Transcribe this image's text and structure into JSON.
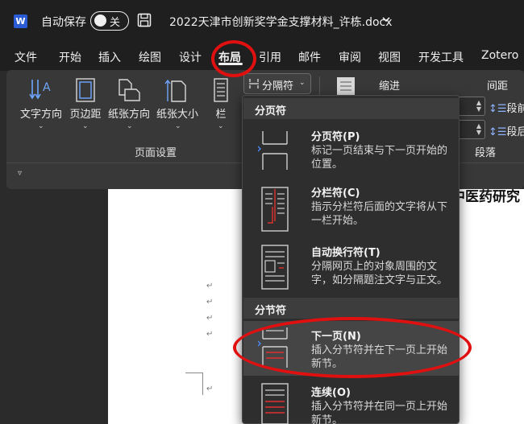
{
  "titlebar": {
    "app_icon": "W",
    "autosave_label": "自动保存",
    "toggle_state": "关",
    "doc_title": "2022天津市创新奖学金支撑材料_许栋.docx"
  },
  "tabs": {
    "file": "文件",
    "home": "开始",
    "insert": "插入",
    "draw": "绘图",
    "design": "设计",
    "layout": "布局",
    "references": "引用",
    "mailings": "邮件",
    "review": "审阅",
    "view": "视图",
    "developer": "开发工具",
    "zotero": "Zotero"
  },
  "ribbon": {
    "text_direction": "文字方向",
    "margins": "页边距",
    "orientation": "纸张方向",
    "size": "纸张大小",
    "columns": "栏",
    "breaks": "分隔符",
    "page_setup_group": "页面设置",
    "indent_label": "缩进",
    "spacing_label": "间距",
    "spacing_before": "段前",
    "spacing_after": "段后",
    "paragraph_group": "段落"
  },
  "document": {
    "snippet": "中医药研究",
    "para_mark": "↵"
  },
  "dropdown": {
    "page_breaks_header": "分页符",
    "section_breaks_header": "分节符",
    "items": [
      {
        "title": "分页符(P)",
        "desc": "标记一页结束与下一页开始的位置。"
      },
      {
        "title": "分栏符(C)",
        "desc": "指示分栏符后面的文字将从下一栏开始。"
      },
      {
        "title": "自动换行符(T)",
        "desc": "分隔网页上的对象周围的文字，如分隔题注文字与正文。"
      },
      {
        "title": "下一页(N)",
        "desc": "插入分节符并在下一页上开始新节。"
      },
      {
        "title": "连续(O)",
        "desc": "插入分节符并在同一页上开始新节。"
      }
    ]
  },
  "colors": {
    "accent_red": "#e01010",
    "word_blue": "#2b5cd6"
  }
}
